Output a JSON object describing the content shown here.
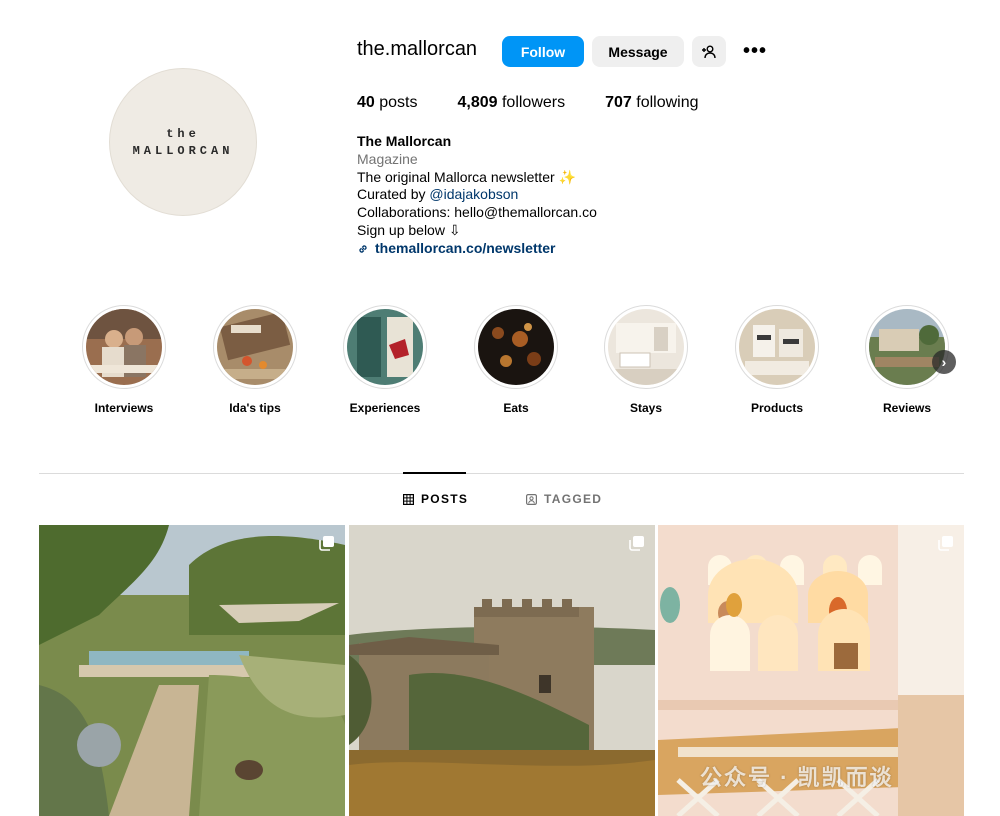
{
  "profile": {
    "avatar_line1": "the",
    "avatar_line2": "MALLORCAN",
    "username": "the.mallorcan",
    "follow_label": "Follow",
    "message_label": "Message",
    "suggest_icon": "add-person-icon",
    "more_icon": "more-options-icon",
    "more_glyph": "•••"
  },
  "stats": {
    "posts_count": "40",
    "posts_label": " posts",
    "followers_count": "4,809",
    "followers_label": " followers",
    "following_count": "707",
    "following_label": " following"
  },
  "bio": {
    "name": "The Mallorcan",
    "category": "Magazine",
    "line1": "The original Mallorca newsletter ✨",
    "line2_prefix": "Curated by ",
    "line2_mention": "@idajakobson",
    "line3": "Collaborations: hello@themallorcan.co",
    "line4": "Sign up below ⇩",
    "link": "themallorcan.co/newsletter"
  },
  "highlights": [
    {
      "label": "Interviews"
    },
    {
      "label": "Ida's tips"
    },
    {
      "label": "Experiences"
    },
    {
      "label": "Eats"
    },
    {
      "label": "Stays"
    },
    {
      "label": "Products"
    },
    {
      "label": "Reviews"
    }
  ],
  "highlights_next_glyph": "›",
  "tabs": {
    "posts": "POSTS",
    "tagged": "TAGGED"
  },
  "watermark": "公众号 · 凯凯而谈",
  "colors": {
    "follow_blue": "#0095f6",
    "link_blue": "#00376b",
    "muted": "#737373"
  }
}
